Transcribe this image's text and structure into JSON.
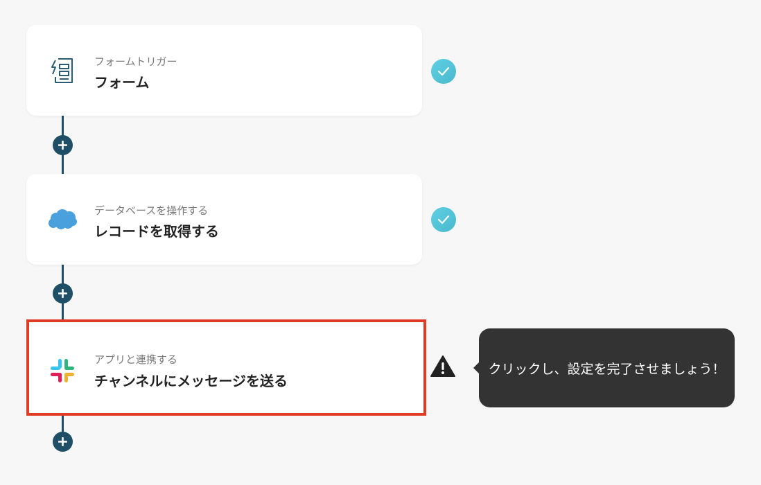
{
  "flow": {
    "steps": [
      {
        "subtitle": "フォームトリガー",
        "title": "フォーム",
        "icon": "form-trigger-icon",
        "status": "complete"
      },
      {
        "subtitle": "データベースを操作する",
        "title": "レコードを取得する",
        "icon": "salesforce-icon",
        "status": "complete"
      },
      {
        "subtitle": "アプリと連携する",
        "title": "チャンネルにメッセージを送る",
        "icon": "slack-icon",
        "status": "warning"
      }
    ],
    "tooltip": "クリックし、設定を完了させましょう！"
  },
  "colors": {
    "connector": "#1e4f66",
    "check": "#4fc0d6",
    "selected_border": "#e03b24",
    "tooltip_bg": "#333333"
  }
}
